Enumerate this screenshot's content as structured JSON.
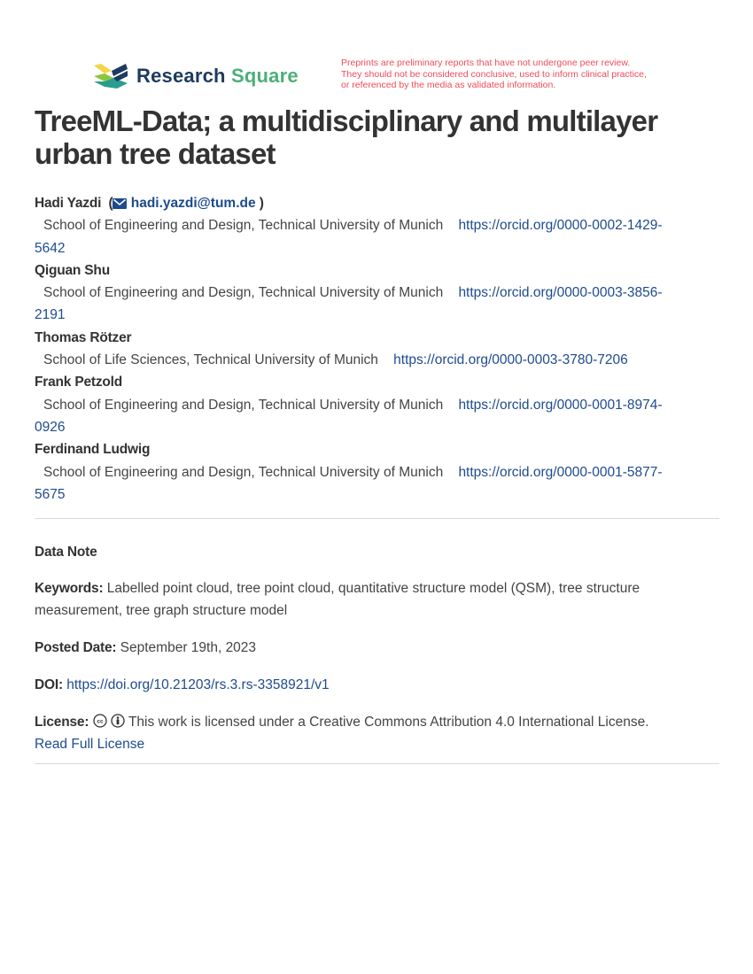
{
  "header": {
    "logo_text_1": "Research",
    "logo_text_2": "Square",
    "notice": [
      "Preprints are preliminary reports that have not undergone peer review.",
      "They should not be considered conclusive, used to inform clinical practice,",
      "or referenced by the media as validated information."
    ],
    "colors": {
      "notice": "#ef4b5a",
      "brand_dark": "#1e3a5f",
      "brand_green": "#4caf7a"
    }
  },
  "title_line1": "TreeML-Data; a multidisciplinary and multilayer",
  "title_line2": "urban tree dataset",
  "authors": [
    {
      "name": "Hadi Yazdi",
      "email": "hadi.yazdi@tum.de",
      "affiliation": "School of Engineering and Design, Technical University of Munich",
      "orcid_a": "https://orcid.org/0000-0002-1429-",
      "orcid_b": "5642"
    },
    {
      "name": "Qiguan Shu",
      "affiliation": "School of Engineering and Design, Technical University of Munich",
      "orcid_a": "https://orcid.org/0000-0003-3856-",
      "orcid_b": "2191"
    },
    {
      "name": "Thomas Rötzer",
      "affiliation": "School of Life Sciences, Technical University of Munich",
      "orcid_a": "https://orcid.org/0000-0003-3780-7206"
    },
    {
      "name": "Frank Petzold",
      "affiliation": "School of Engineering and Design, Technical University of Munich",
      "orcid_a": "https://orcid.org/0000-0001-8974-",
      "orcid_b": "0926"
    },
    {
      "name": "Ferdinand Ludwig",
      "affiliation": "School of Engineering and Design, Technical University of Munich",
      "orcid_a": "https://orcid.org/0000-0001-5877-",
      "orcid_b": "5675"
    }
  ],
  "article_type": "Data Note",
  "keywords_label": "Keywords:",
  "keywords": "Labelled point cloud, tree point cloud, quantitative structure model (QSM), tree structure measurement, tree graph structure model",
  "posted_label": "Posted Date:",
  "posted_date": "September 19th, 2023",
  "doi_label": "DOI:",
  "doi": "https://doi.org/10.21203/rs.3.rs-3358921/v1",
  "license_label": "License:",
  "license_text": "This work is licensed under a Creative Commons Attribution 4.0 International License.",
  "license_link": "Read Full License"
}
